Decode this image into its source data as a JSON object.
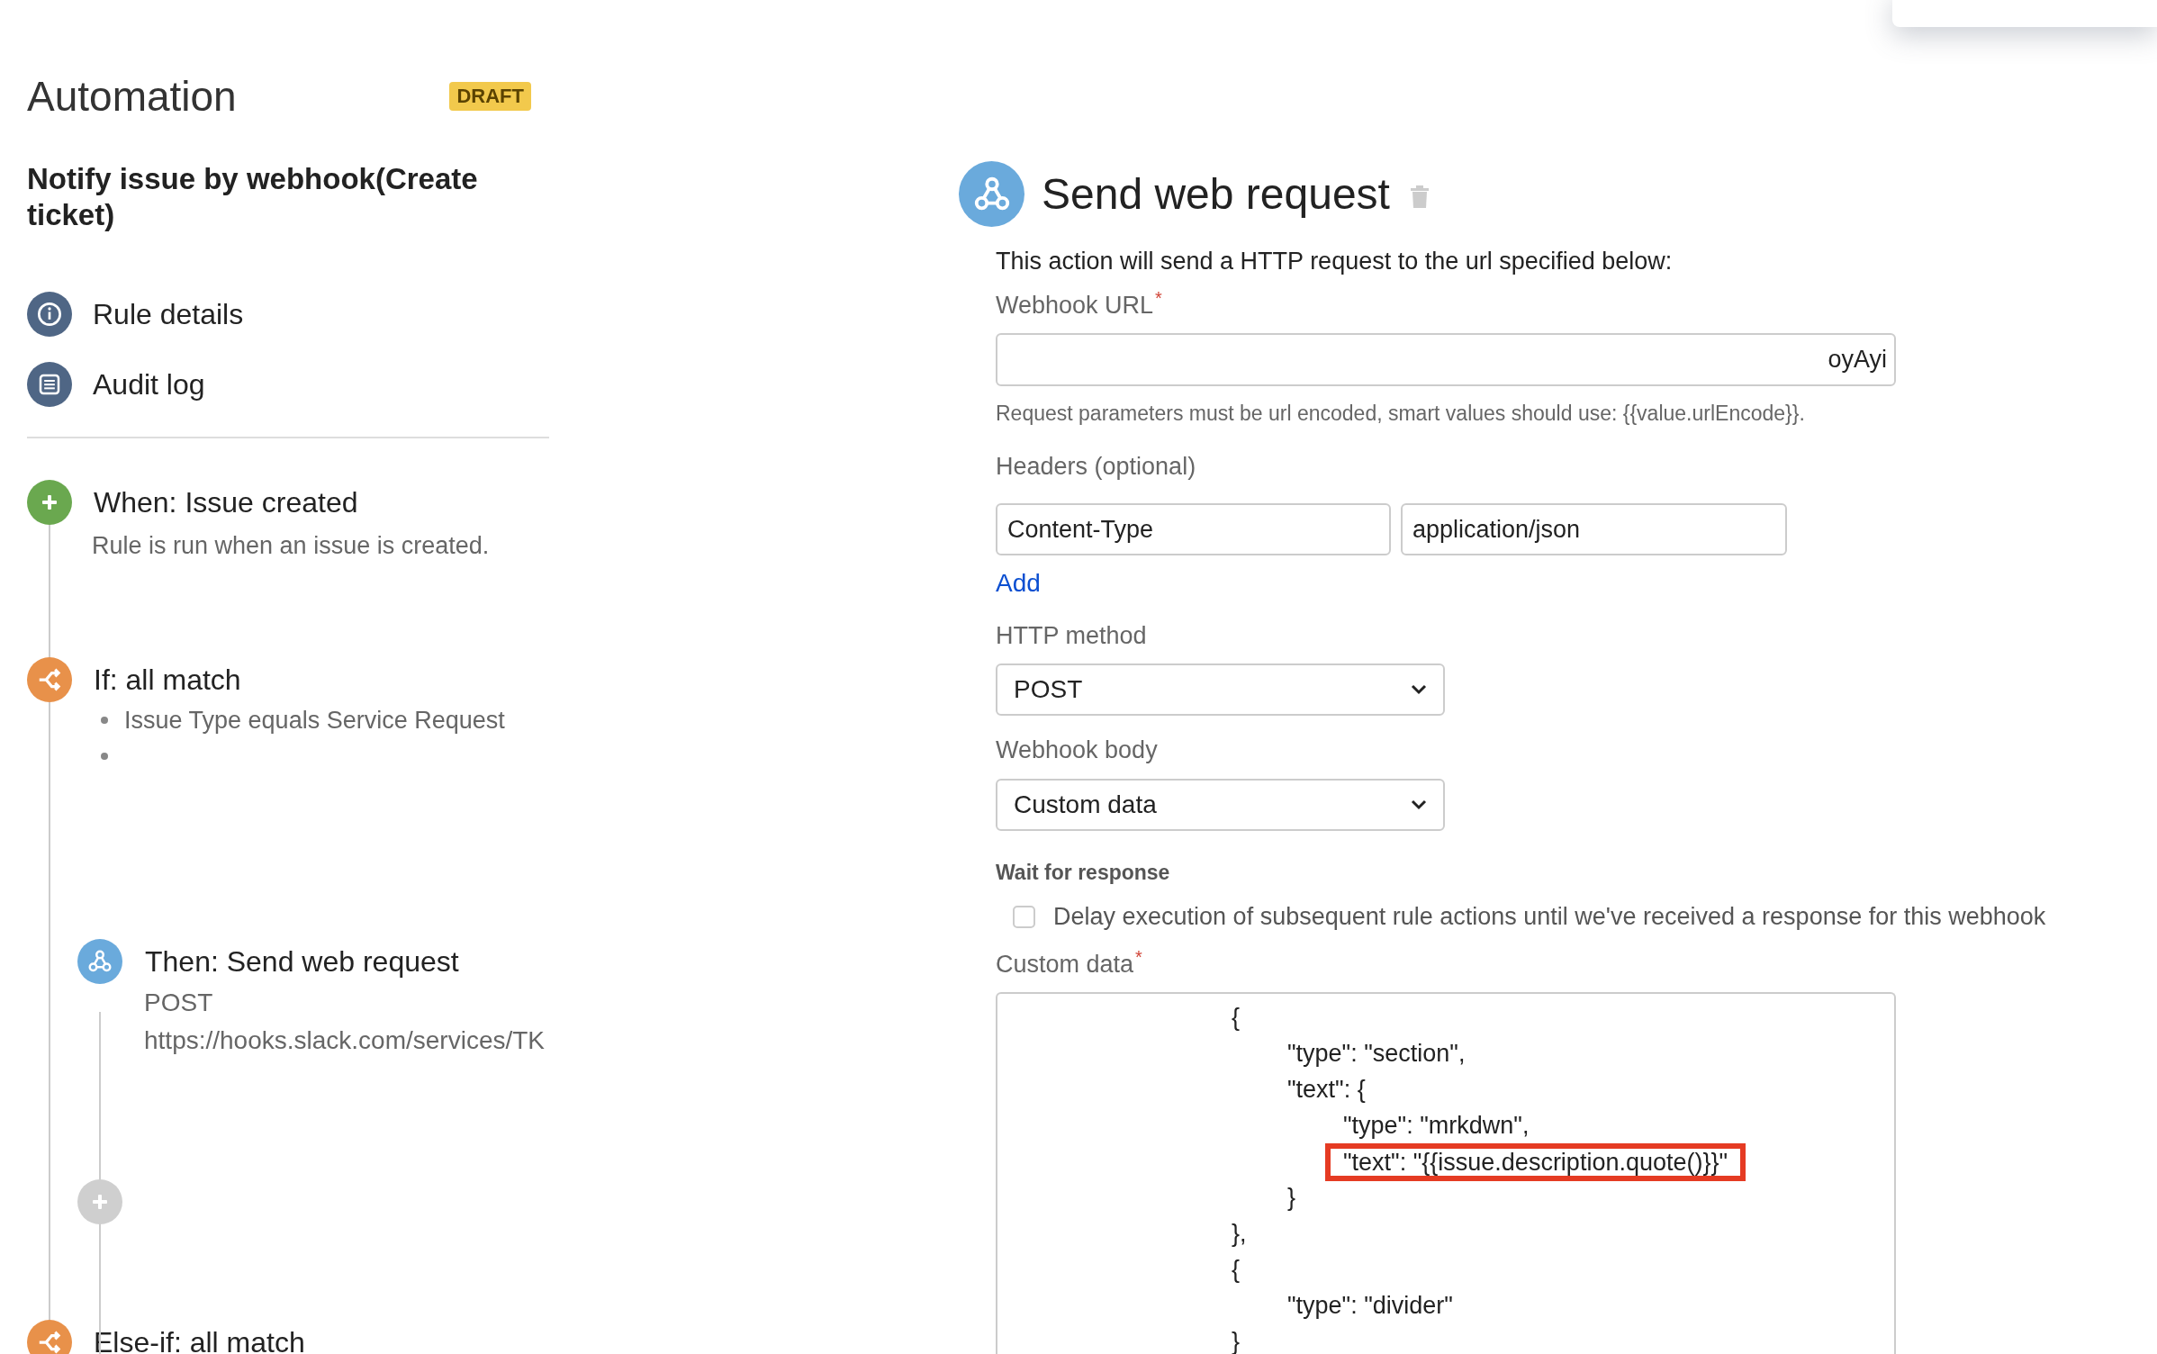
{
  "sidebar": {
    "title": "Automation",
    "badge": "DRAFT",
    "rule_name": "Notify issue by webhook(Create ticket)",
    "nav": [
      {
        "kind": "info",
        "label": "Rule details"
      },
      {
        "kind": "log",
        "label": "Audit log"
      }
    ],
    "steps": [
      {
        "kind": "trigger",
        "title": "When: Issue created",
        "description": "Rule is run when an issue is created."
      },
      {
        "kind": "condition",
        "title": "If: all match",
        "bullets": [
          {
            "text": "Issue Type equals Service Request"
          },
          {
            "kind": "blank"
          }
        ],
        "children": [
          {
            "kind": "action",
            "title": "Then: Send web request",
            "lines": [
              "POST",
              "https://hooks.slack.com/services/TK"
            ]
          },
          {
            "kind": "add"
          }
        ]
      },
      {
        "kind": "condition",
        "title": "Else-if: all match"
      }
    ]
  },
  "panel": {
    "title": "Send web request",
    "intro": "This action will send a HTTP request to the url specified below:",
    "url_label": "Webhook URL",
    "url_label_mark": "*",
    "url_value": "oyAyi",
    "url_help": "Request parameters must be url encoded, smart values should use: {{value.urlEncode}}.",
    "headers_label": "Headers (optional)",
    "headers": [
      {
        "name": "Content-Type",
        "value": "application/json"
      }
    ],
    "add_link": "Add",
    "method_label": "HTTP method",
    "method": "POST",
    "body_label": "Webhook body",
    "body": "Custom data",
    "wait_label": "Wait for response",
    "wait_checkbox": {
      "label": "Delay execution of subsequent rule actions until we've received a response for this webhook",
      "checked": false
    },
    "custom_label": "Custom data",
    "custom_label_mark": "*",
    "custom_lines": [
      {
        "text": "\t\t\t\t{",
        "highlighted": false
      },
      {
        "text": "\t\t\t\t\t\"type\": \"section\",",
        "highlighted": false
      },
      {
        "text": "\t\t\t\t\t\"text\": {",
        "highlighted": false
      },
      {
        "text": "\t\t\t\t\t\t\"type\": \"mrkdwn\",",
        "highlighted": false
      },
      {
        "text": "\t\t\t\t\t\t\"text\": \"{{issue.description.quote()}}\"",
        "highlighted": true
      },
      {
        "text": "\t\t\t\t\t}",
        "highlighted": false
      },
      {
        "text": "\t\t\t\t},",
        "highlighted": false
      },
      {
        "text": "\t\t\t\t{",
        "highlighted": false
      },
      {
        "text": "\t\t\t\t\t\"type\": \"divider\"",
        "highlighted": false
      },
      {
        "text": "\t\t\t\t}",
        "highlighted": false
      }
    ]
  }
}
